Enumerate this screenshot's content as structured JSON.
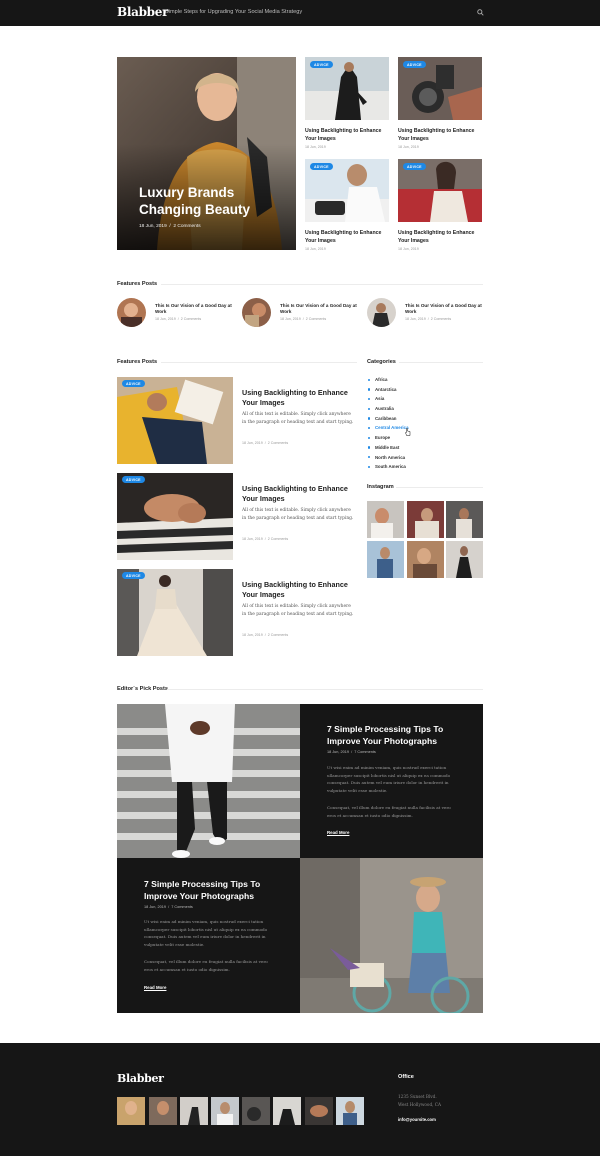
{
  "header": {
    "logo": "Blabber",
    "tagline": "Simple Steps for Upgrading Your Social Media Strategy"
  },
  "hero": {
    "title": "Luxury Brands Changing Beauty",
    "date": "18 Jun, 2019",
    "comments": "2 Comments",
    "grid": [
      {
        "tag": "ADVICE",
        "title": "Using Backlighting to Enhance Your Images",
        "date": "18 Jun, 2019"
      },
      {
        "tag": "ADVICE",
        "title": "Using Backlighting to Enhance Your Images",
        "date": "18 Jun, 2019"
      },
      {
        "tag": "ADVICE",
        "title": "Using Backlighting to Enhance Your Images",
        "date": "18 Jun, 2019"
      },
      {
        "tag": "ADVICE",
        "title": "Using Backlighting to Enhance Your Images",
        "date": "18 Jun, 2019"
      }
    ]
  },
  "featured_strip": {
    "heading": "Features Posts",
    "items": [
      {
        "title": "This Is Our Vision of a Good Day at Work",
        "date": "18 Jun, 2019",
        "comments": "2 Comments"
      },
      {
        "title": "This Is Our Vision of a Good Day at Work",
        "date": "18 Jun, 2019",
        "comments": "2 Comments"
      },
      {
        "title": "This Is Our Vision of a Good Day at Work",
        "date": "18 Jun, 2019",
        "comments": "2 Comments"
      }
    ]
  },
  "feature_posts": {
    "heading": "Features Posts",
    "posts": [
      {
        "tag": "ADVICE",
        "title": "Using Backlighting to Enhance Your Images",
        "excerpt": "All of this text is editable. Simply click anywhere in the paragraph or heading text and start typing.",
        "date": "18 Jun, 2019",
        "comments": "2 Comments"
      },
      {
        "tag": "ADVICE",
        "title": "Using Backlighting to Enhance Your Images",
        "excerpt": "All of this text is editable. Simply click anywhere in the paragraph or heading text and start typing.",
        "date": "18 Jun, 2019",
        "comments": "2 Comments"
      },
      {
        "tag": "ADVICE",
        "title": "Using Backlighting to Enhance Your Images",
        "excerpt": "All of this text is editable. Simply click anywhere in the paragraph or heading text and start typing.",
        "date": "18 Jun, 2019",
        "comments": "2 Comments"
      }
    ]
  },
  "categories": {
    "heading": "Categories",
    "items": [
      "Africa",
      "Antarctica",
      "Asia",
      "Australia",
      "Caribbean",
      "Central America",
      "Europe",
      "Middle East",
      "North America",
      "South America"
    ],
    "active_index": 5
  },
  "instagram": {
    "heading": "Instagram"
  },
  "editors_pick": {
    "heading": "Editor`s Pick Posts",
    "posts": [
      {
        "title": "7 Simple Processing Tips To Improve Your Photographs",
        "date": "18 Jun, 2019",
        "comments": "7 Comments",
        "p1": "Ut wisi enim ad minim veniam, quis nostrud exerci tation ullamcorper suscipit lobortis nisl ut aliquip ex ea commodo consequat. Duis autem vel eum iriure dolor in hendrerit in vulputate velit esse molestie.",
        "p2": "Consequat, vel illum dolore eu feugiat nulla facilisis at vero eros et accumsan et iusto odio dignissim.",
        "more": "Read More"
      },
      {
        "title": "7 Simple Processing Tips To Improve Your Photographs",
        "date": "18 Jun, 2019",
        "comments": "7 Comments",
        "p1": "Ut wisi enim ad minim veniam, quis nostrud exerci tation ullamcorper suscipit lobortis nisl ut aliquip ex ea commodo consequat. Duis autem vel eum iriure dolor in hendrerit in vulputate velit esse molestie.",
        "p2": "Consequat, vel illum dolore eu feugiat nulla facilisis at vero eros et accumsan et iusto odio dignissim.",
        "more": "Read More"
      }
    ]
  },
  "footer": {
    "logo": "Blabber",
    "office_heading": "Office",
    "address_line1": "1235 Sunset Blvd.",
    "address_line2": "West Hollywood, CA",
    "email": "info@yoursite.com"
  },
  "colors": {
    "accent": "#1e88e5",
    "dark": "#161616"
  },
  "icons": {
    "search": "search-icon"
  }
}
